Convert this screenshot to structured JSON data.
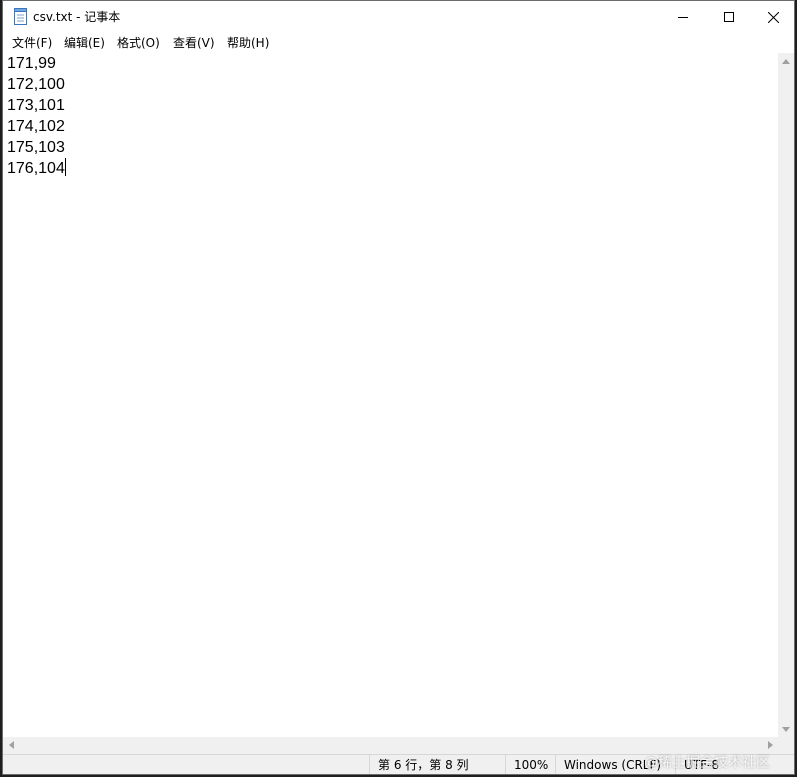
{
  "window": {
    "title": "csv.txt - 记事本"
  },
  "menu": [
    {
      "label": "文件(F)"
    },
    {
      "label": "编辑(E)"
    },
    {
      "label": "格式(O)"
    },
    {
      "label": "查看(V)"
    },
    {
      "label": "帮助(H)"
    }
  ],
  "editor": {
    "lines": [
      "171,99",
      "172,100",
      "173,101",
      "174,102",
      "175,103",
      "176,104"
    ]
  },
  "status": {
    "position": "第 6 行，第 8 列",
    "zoom": "100%",
    "line_ending": "Windows (CRLF)",
    "encoding": "UTF-8"
  },
  "watermark": "@稀土掘金技术社区",
  "icons": {
    "app": "notepad-icon",
    "minimize": "minimize-icon",
    "maximize": "maximize-icon",
    "close": "close-icon"
  }
}
